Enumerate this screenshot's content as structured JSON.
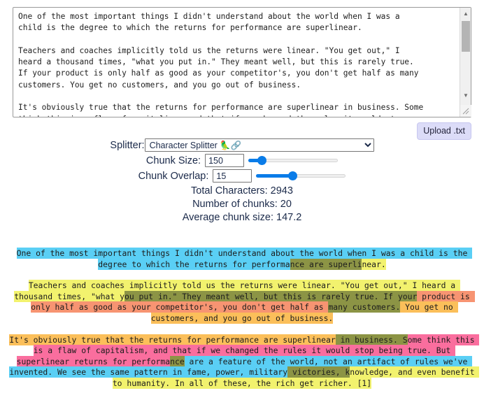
{
  "document_textarea": {
    "name": "source-text",
    "value": "One of the most important things I didn't understand about the world when I was a\nchild is the degree to which the returns for performance are superlinear.\n\nTeachers and coaches implicitly told us the returns were linear. \"You get out,\" I\nheard a thousand times, \"what you put in.\" They meant well, but this is rarely true.\nIf your product is only half as good as your competitor's, you don't get half as many\ncustomers. You get no customers, and you go out of business.\n\nIt's obviously true that the returns for performance are superlinear in business. Some\nthink this is a flaw of capitalism, and that if we changed the rules it would stop"
  },
  "upload": {
    "label": "Upload .txt"
  },
  "controls": {
    "splitter_label": "Splitter:",
    "splitter_value": "Character Splitter 🦜🔗",
    "splitter_options": [
      "Character Splitter 🦜🔗"
    ],
    "chunk_size_label": "Chunk Size:",
    "chunk_size_value": "150",
    "chunk_size_percent": 15,
    "chunk_overlap_label": "Chunk Overlap:",
    "chunk_overlap_value": "15",
    "chunk_overlap_percent": 40
  },
  "stats": {
    "total_characters": "Total Characters: 2943",
    "number_of_chunks": "Number of chunks: 20",
    "average_chunk_size": "Average chunk size: 147.2"
  },
  "colors": {
    "cyan": "#5ACFF5",
    "yellow": "#F2F26E",
    "olive_cyan_yellow": "#8C9445",
    "salmon": "#F79472",
    "olive_yellow_salmon": "#8C9445",
    "orange": "#FBBF5A",
    "pink": "#FA6E9E",
    "olive_orange_pink": "#8C9445",
    "button_bg": "#DCDCF8",
    "slider_blue": "#0A7CE8",
    "text": "#1C1C1C",
    "label_text": "#1B2A4A"
  },
  "chunk_view": {
    "paragraphs": [
      {
        "id": "para-1",
        "segments": [
          {
            "text": "One of the most important things I didn't understand about the world when I was a child is the degree to which the returns for performa",
            "color": "cyan"
          },
          {
            "text": "nce are superli",
            "color": "olive"
          },
          {
            "text": "near.",
            "color": "yellow"
          }
        ]
      },
      {
        "id": "para-2",
        "segments": [
          {
            "text": "Teachers and coaches implicitly told us the returns were linear. \"You get out,\" I heard a thousand times, \"what y",
            "color": "yellow"
          },
          {
            "text": "ou put in.\" They meant well, but this is rarely true. If your",
            "color": "olive"
          },
          {
            "text": " product is only half as good as your competitor's, you don't get half as ",
            "color": "salmon"
          },
          {
            "text": "many customers.",
            "color": "olive"
          },
          {
            "text": " You get no customers, and you go out of business.",
            "color": "orange"
          }
        ]
      },
      {
        "id": "para-3",
        "segments": [
          {
            "text": "It's obviously true that the returns for performance are superlinear",
            "color": "orange"
          },
          {
            "text": " in business. S",
            "color": "olive"
          },
          {
            "text": "ome think this is a flaw of capitalism, and that if we changed the rules it would stop being true. But superlinear returns for performa",
            "color": "pink"
          },
          {
            "text": "nce",
            "color": "olive"
          },
          {
            "text": " are a feature of the world, not an artifact of rules we've invented. We see the same pattern in fame, power, military",
            "color": "cyan"
          },
          {
            "text": " victories, k",
            "color": "olive"
          },
          {
            "text": "nowledge, and even benefit to humanity. In all of these, the rich get richer. [1]",
            "color": "yellow"
          }
        ]
      }
    ]
  }
}
